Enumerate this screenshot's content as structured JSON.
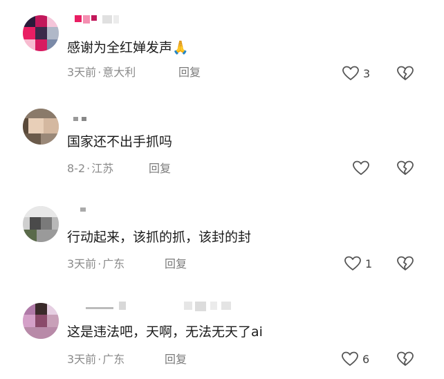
{
  "comments": [
    {
      "text": "感谢为全红婵发声🙏",
      "time": "3天前",
      "sep": "·",
      "location": "意大利",
      "reply_label": "回复",
      "likes": "3"
    },
    {
      "text": "国家还不出手抓吗",
      "time": "8-2",
      "sep": "·",
      "location": "江苏",
      "reply_label": "回复",
      "likes": ""
    },
    {
      "text": "行动起来，该抓的抓，该封的封",
      "time": "3天前",
      "sep": "·",
      "location": "广东",
      "reply_label": "回复",
      "likes": "1"
    },
    {
      "text": "这是违法吧，天啊，无法无天了ai",
      "time": "3天前",
      "sep": "·",
      "location": "广东",
      "reply_label": "回复",
      "likes": "6"
    }
  ],
  "icons": {
    "like": "heart-outline-icon",
    "dislike": "broken-heart-outline-icon"
  },
  "colors": {
    "text": "#1a1a1a",
    "meta": "#8a8a8a",
    "icon_stroke": "#555555"
  }
}
